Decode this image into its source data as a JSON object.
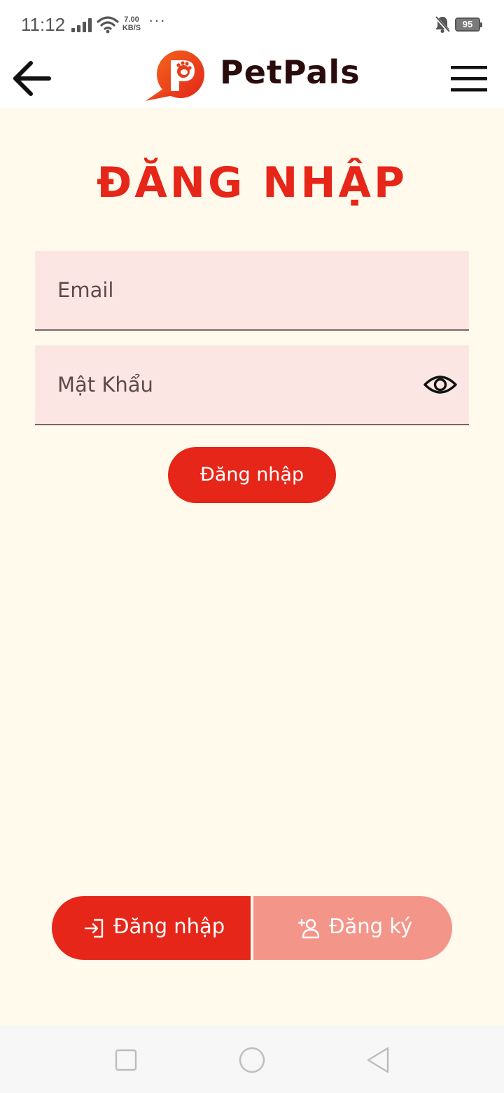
{
  "status_bar": {
    "time": "11:12",
    "net_speed_value": "7.00",
    "net_speed_unit": "KB/S",
    "more": "···",
    "battery": "95",
    "icons": [
      "signal-icon",
      "wifi-icon",
      "bell-muted-icon",
      "battery-icon"
    ]
  },
  "header": {
    "app_name": "PetPals",
    "back_icon": "arrow-left-icon",
    "menu_icon": "hamburger-menu-icon",
    "logo_icon": "speech-bubble-paw-logo"
  },
  "page": {
    "title": "ĐĂNG NHẬP"
  },
  "form": {
    "email_placeholder": "Email",
    "email_value": "",
    "password_placeholder": "Mật Khẩu",
    "password_value": "",
    "password_toggle_icon": "eye-icon",
    "submit_label": "Đăng nhập"
  },
  "switcher": {
    "login_label": "Đăng nhập",
    "login_icon": "login-arrow-icon",
    "register_label": "Đăng ký",
    "register_icon": "add-user-icon",
    "active": "login"
  },
  "nav_bar": {
    "icons": [
      "recents-square-icon",
      "home-circle-icon",
      "back-triangle-icon"
    ]
  },
  "colors": {
    "background": "#fffaec",
    "accent": "#e52618",
    "accent_light": "#f4958a",
    "input_bg": "#fce6e4",
    "logo_dark": "#2b0c0c"
  }
}
